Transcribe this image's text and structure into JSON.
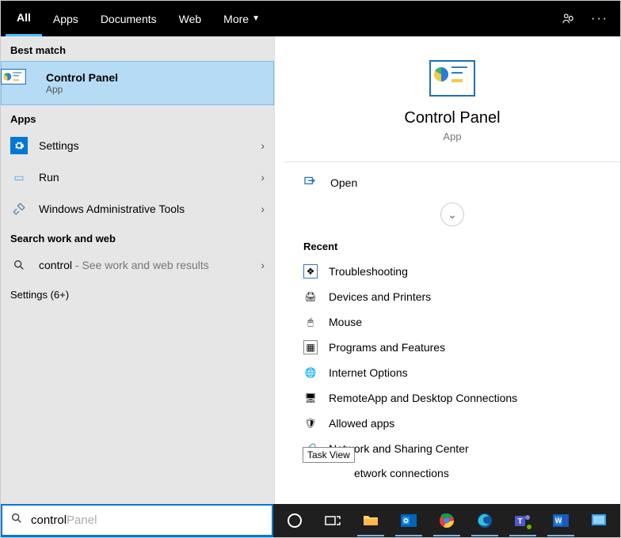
{
  "tabs": {
    "all": "All",
    "apps": "Apps",
    "documents": "Documents",
    "web": "Web",
    "more": "More"
  },
  "left": {
    "best_match_label": "Best match",
    "best_match": {
      "title": "Control Panel",
      "sub": "App"
    },
    "apps_label": "Apps",
    "apps": [
      {
        "label": "Settings",
        "icon": "gear"
      },
      {
        "label": "Run",
        "icon": "run"
      },
      {
        "label": "Windows Administrative Tools",
        "icon": "admin"
      }
    ],
    "search_work_web_label": "Search work and web",
    "work_web": {
      "term": "control",
      "hint": " - See work and web results"
    },
    "settings_more": "Settings (6+)"
  },
  "right": {
    "title": "Control Panel",
    "sub": "App",
    "open": "Open",
    "recent_label": "Recent",
    "recent": [
      "Troubleshooting",
      "Devices and Printers",
      "Mouse",
      "Programs and Features",
      "Internet Options",
      "RemoteApp and Desktop Connections",
      "Allowed apps",
      "Network and Sharing Center",
      "etwork connections"
    ],
    "tooltip": "Task View"
  },
  "search": {
    "typed": "control",
    "ghost": " Panel"
  }
}
